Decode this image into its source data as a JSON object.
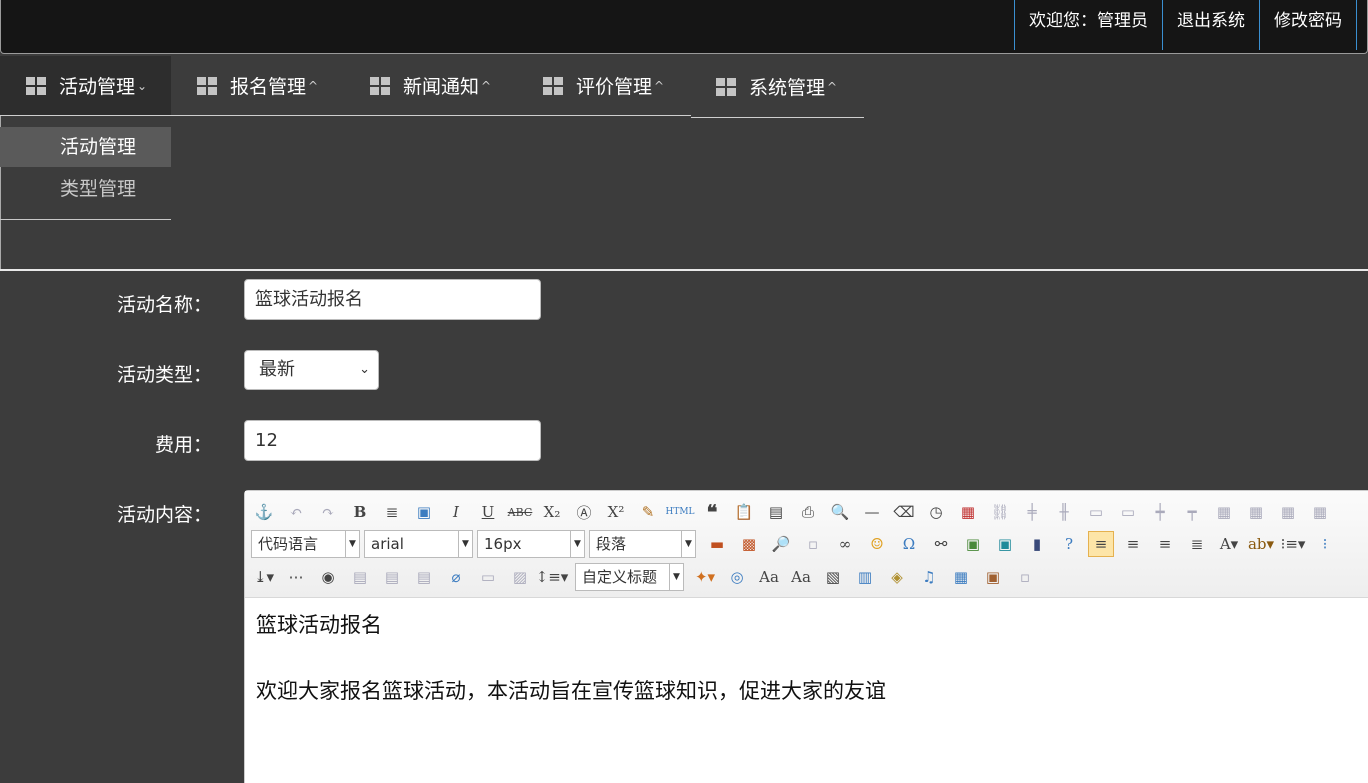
{
  "header": {
    "welcome": "欢迎您：管理员",
    "logout": "退出系统",
    "change_password": "修改密码"
  },
  "nav": {
    "tabs": [
      {
        "label": "活动管理",
        "caret": "⌄"
      },
      {
        "label": "报名管理",
        "caret": "^"
      },
      {
        "label": "新闻通知",
        "caret": "^"
      },
      {
        "label": "评价管理",
        "caret": "^"
      },
      {
        "label": "系统管理",
        "caret": "^"
      }
    ]
  },
  "submenu": {
    "items": [
      {
        "label": "活动管理"
      },
      {
        "label": "类型管理"
      }
    ]
  },
  "form": {
    "name_label": "活动名称：",
    "name_value": "篮球活动报名",
    "type_label": "活动类型：",
    "type_value": "最新",
    "fee_label": "费用：",
    "fee_value": "12",
    "content_label": "活动内容："
  },
  "editor": {
    "font_family": "代码语言",
    "font_name": "arial",
    "font_size": "16px",
    "paragraph": "段落",
    "custom_title": "自定义标题",
    "content": {
      "title": "篮球活动报名",
      "body": "欢迎大家报名篮球活动，本活动旨在宣传篮球知识，促进大家的友谊"
    }
  }
}
